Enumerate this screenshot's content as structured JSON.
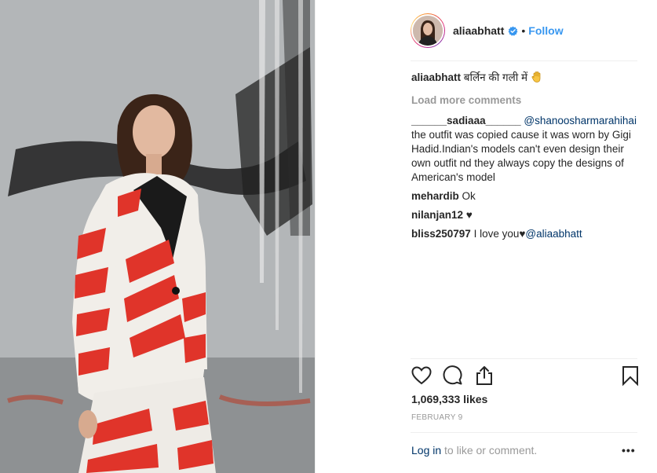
{
  "post": {
    "username": "aliaabhatt",
    "follow_label": "Follow",
    "separator": "•",
    "verified_icon": "verified-badge-icon",
    "accent_color": "#3897f0"
  },
  "caption": {
    "username": "aliaabhatt",
    "text": "बर्लिन की गली में ",
    "emoji": "waving-hand-emoji"
  },
  "load_more_label": "Load more comments",
  "comments": [
    {
      "username": "______sadiaaa______",
      "mention": "@shanoosharmarahihai",
      "text": "the outfit was copied cause it was worn by Gigi Hadid.Indian's models can't even design their own outfit nd they always copy the designs of American's model"
    },
    {
      "username": "mehardib",
      "text": "Ok"
    },
    {
      "username": "nilanjan12",
      "text": "♥"
    },
    {
      "username": "bliss250797",
      "text": "I love you♥",
      "mention": "@aliaabhatt"
    }
  ],
  "actions": {
    "like_icon": "heart-icon",
    "comment_icon": "comment-icon",
    "share_icon": "share-icon",
    "save_icon": "bookmark-icon"
  },
  "likes": "1,069,333 likes",
  "date": "FEBRUARY 9",
  "login": {
    "link": "Log in",
    "rest": " to like or comment."
  },
  "more_label": "•••"
}
